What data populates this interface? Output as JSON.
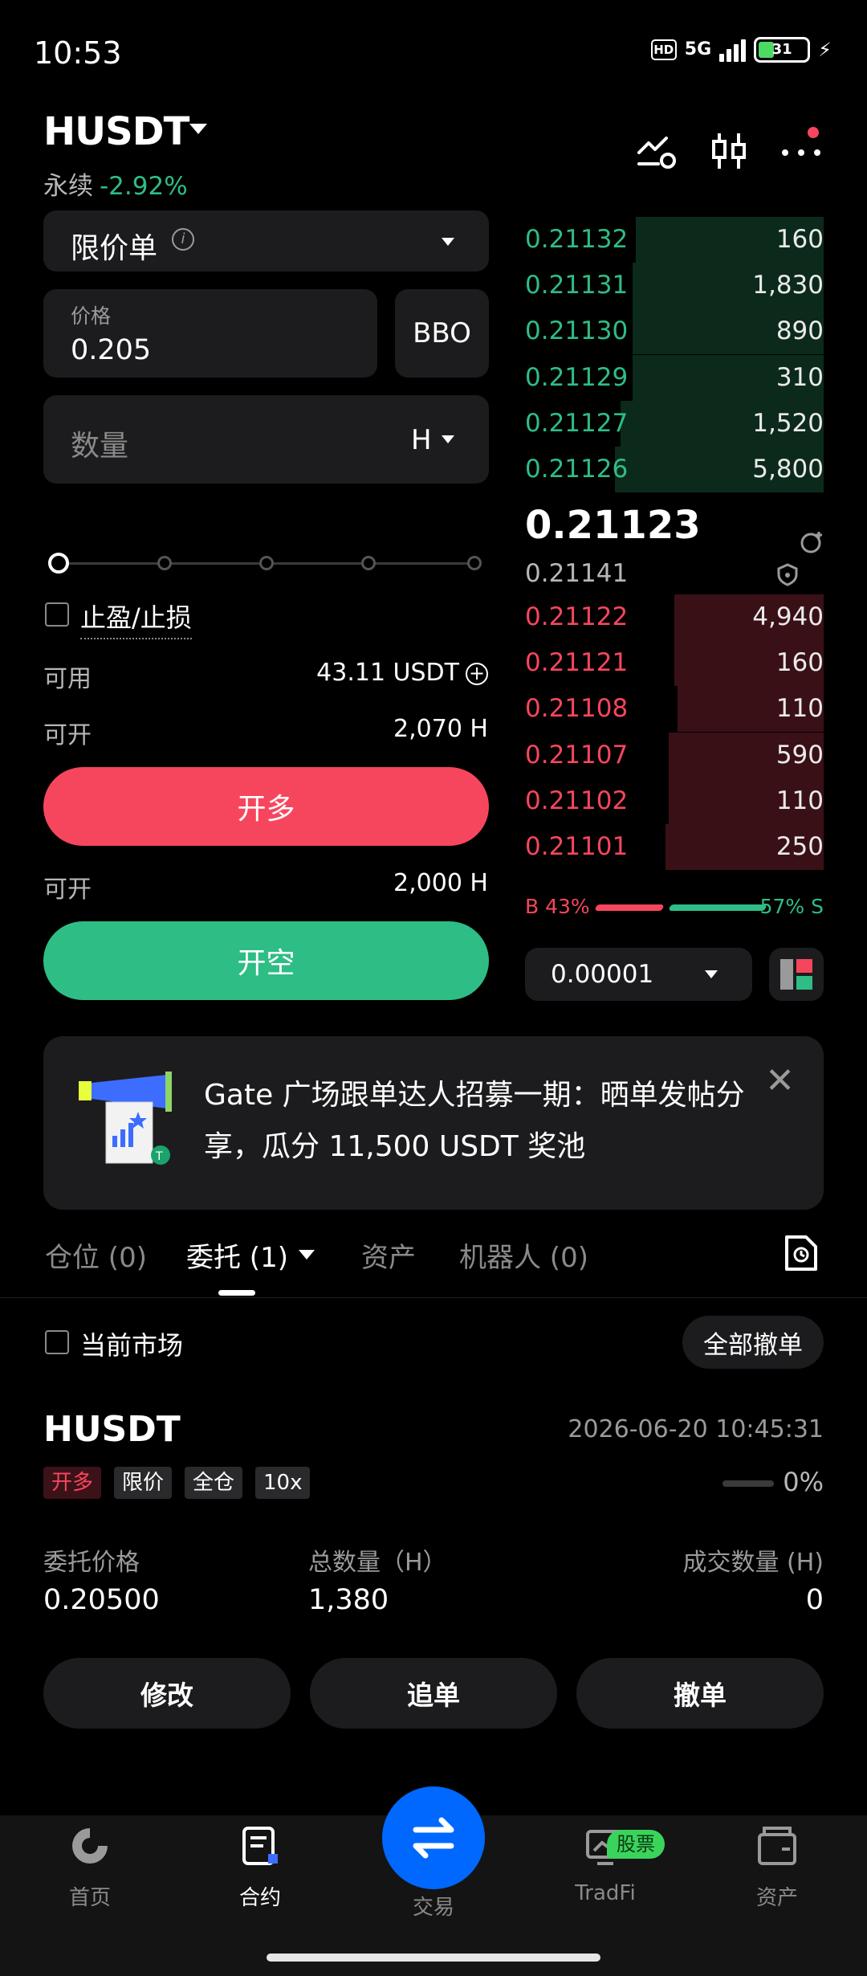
{
  "status_bar": {
    "time": "10:53",
    "network": "5G",
    "hd": "HD",
    "battery": "31"
  },
  "header": {
    "pair": "HUSDT",
    "contract_type": "永续",
    "change": "-2.92%"
  },
  "order_form": {
    "order_type": "限价单",
    "price_label": "价格",
    "price_value": "0.205",
    "bbo_label": "BBO",
    "qty_placeholder": "数量",
    "qty_unit": "H",
    "tpsl_label": "止盈/止损",
    "available_label": "可用",
    "available_value": "43.11 USDT",
    "long_open_label": "可开",
    "long_open_value": "2,070 H",
    "long_button": "开多",
    "short_open_label": "可开",
    "short_open_value": "2,000 H",
    "short_button": "开空",
    "slider_level_pct": 0
  },
  "orderbook": {
    "asks": [
      {
        "price": "0.21132",
        "size": "160",
        "depth": 0.63
      },
      {
        "price": "0.21131",
        "size": "1,830",
        "depth": 0.64
      },
      {
        "price": "0.21130",
        "size": "890",
        "depth": 0.64
      },
      {
        "price": "0.21129",
        "size": "310",
        "depth": 0.64
      },
      {
        "price": "0.21127",
        "size": "1,520",
        "depth": 0.68
      },
      {
        "price": "0.21126",
        "size": "5,800",
        "depth": 0.7
      }
    ],
    "last_price": "0.21123",
    "mark_price": "0.21141",
    "bids": [
      {
        "price": "0.21122",
        "size": "4,940",
        "depth": 0.5
      },
      {
        "price": "0.21121",
        "size": "160",
        "depth": 0.5
      },
      {
        "price": "0.21108",
        "size": "110",
        "depth": 0.49
      },
      {
        "price": "0.21107",
        "size": "590",
        "depth": 0.52
      },
      {
        "price": "0.21102",
        "size": "110",
        "depth": 0.52
      },
      {
        "price": "0.21101",
        "size": "250",
        "depth": 0.53
      }
    ],
    "buy_ratio": "B 43%",
    "sell_ratio": "57% S",
    "precision": "0.00001"
  },
  "banner": {
    "text": "Gate 广场跟单达人招募一期：晒单发帖分享，瓜分 11,500 USDT 奖池"
  },
  "tabs": [
    {
      "label": "仓位 (0)"
    },
    {
      "label": "委托 (1)"
    },
    {
      "label": "资产"
    },
    {
      "label": "机器人 (0)"
    }
  ],
  "filter": {
    "current_market": "当前市场",
    "cancel_all": "全部撤单"
  },
  "order": {
    "symbol": "HUSDT",
    "time": "2026-06-20 10:45:31",
    "tags": [
      "开多",
      "限价",
      "全仓",
      "10x"
    ],
    "fill_pct": "0%",
    "price_label": "委托价格",
    "price_value": "0.20500",
    "total_label": "总数量（H）",
    "total_value": "1,380",
    "filled_label": "成交数量 (H)",
    "filled_value": "0",
    "actions": [
      "修改",
      "追单",
      "撤单"
    ]
  },
  "nav": {
    "items": [
      {
        "label": "首页",
        "icon": "home-icon"
      },
      {
        "label": "合约",
        "icon": "contract-icon"
      },
      {
        "label": "交易",
        "icon": "swap-icon"
      },
      {
        "label": "TradFi",
        "icon": "tradfi-icon",
        "badge": "股票"
      },
      {
        "label": "资产",
        "icon": "wallet-icon"
      }
    ]
  }
}
